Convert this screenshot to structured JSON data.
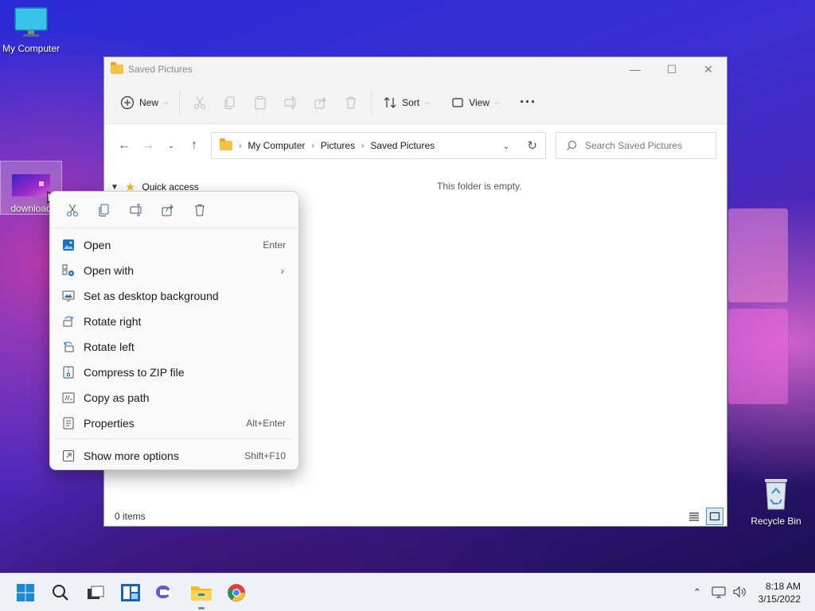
{
  "desktop": {
    "icons": {
      "my_computer": "My Computer",
      "download": "download",
      "recycle_bin": "Recycle Bin"
    }
  },
  "explorer": {
    "title": "Saved Pictures",
    "toolbar": {
      "new_label": "New",
      "sort_label": "Sort",
      "view_label": "View"
    },
    "breadcrumb": [
      "My Computer",
      "Pictures",
      "Saved Pictures"
    ],
    "search_placeholder": "Search Saved Pictures",
    "nav": {
      "quick_access": "Quick access"
    },
    "empty_message": "This folder is empty.",
    "status_items": "0 items"
  },
  "context_menu": {
    "items": [
      {
        "label": "Open",
        "shortcut": "Enter"
      },
      {
        "label": "Open with",
        "shortcut": ""
      },
      {
        "label": "Set as desktop background",
        "shortcut": ""
      },
      {
        "label": "Rotate right",
        "shortcut": ""
      },
      {
        "label": "Rotate left",
        "shortcut": ""
      },
      {
        "label": "Compress to ZIP file",
        "shortcut": ""
      },
      {
        "label": "Copy as path",
        "shortcut": ""
      },
      {
        "label": "Properties",
        "shortcut": "Alt+Enter"
      }
    ],
    "more_options": {
      "label": "Show more options",
      "shortcut": "Shift+F10"
    }
  },
  "taskbar": {
    "time": "8:18 AM",
    "date": "3/15/2022"
  },
  "colors": {
    "accent": "#0067c0",
    "folder_yellow": "#f5c344"
  }
}
